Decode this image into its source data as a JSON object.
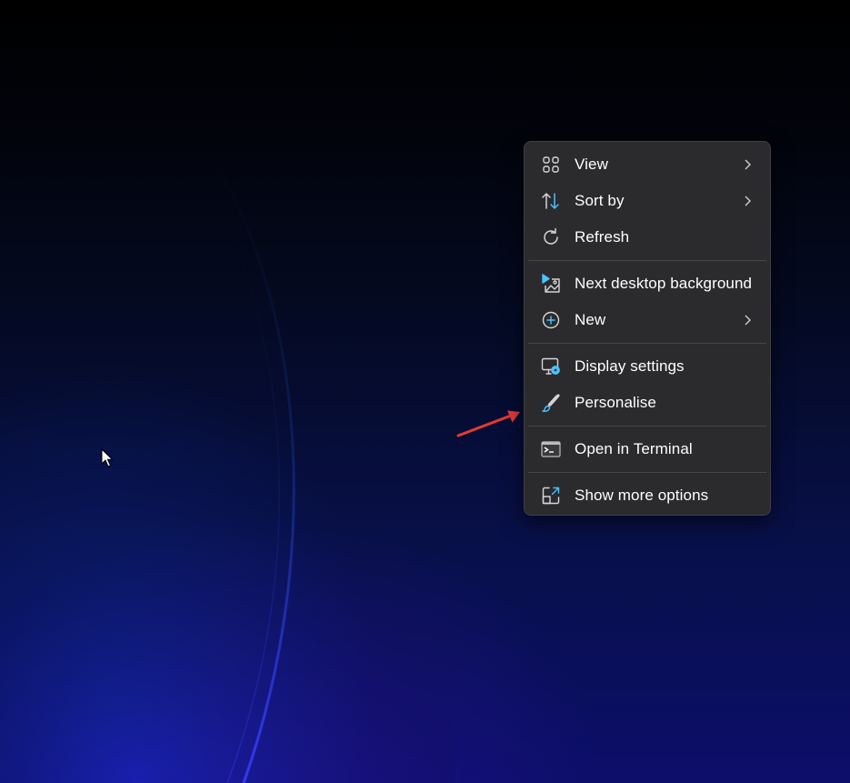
{
  "desktop": {
    "context_menu": {
      "groups": [
        [
          {
            "label": "View",
            "icon": "view-grid-icon",
            "has_submenu": true
          },
          {
            "label": "Sort by",
            "icon": "sort-icon",
            "has_submenu": true
          },
          {
            "label": "Refresh",
            "icon": "refresh-icon",
            "has_submenu": false
          }
        ],
        [
          {
            "label": "Next desktop background",
            "icon": "next-background-icon",
            "has_submenu": false
          },
          {
            "label": "New",
            "icon": "new-plus-icon",
            "has_submenu": true
          }
        ],
        [
          {
            "label": "Display settings",
            "icon": "display-settings-icon",
            "has_submenu": false
          },
          {
            "label": "Personalise",
            "icon": "brush-icon",
            "has_submenu": false
          }
        ],
        [
          {
            "label": "Open in Terminal",
            "icon": "terminal-icon",
            "has_submenu": false
          }
        ],
        [
          {
            "label": "Show more options",
            "icon": "show-more-options-icon",
            "has_submenu": false
          }
        ]
      ]
    }
  },
  "colors": {
    "menu_background": "#2b2b2e",
    "menu_text": "#ffffff",
    "accent_blue": "#4cc2ff",
    "annotation_arrow": "#e53935"
  }
}
